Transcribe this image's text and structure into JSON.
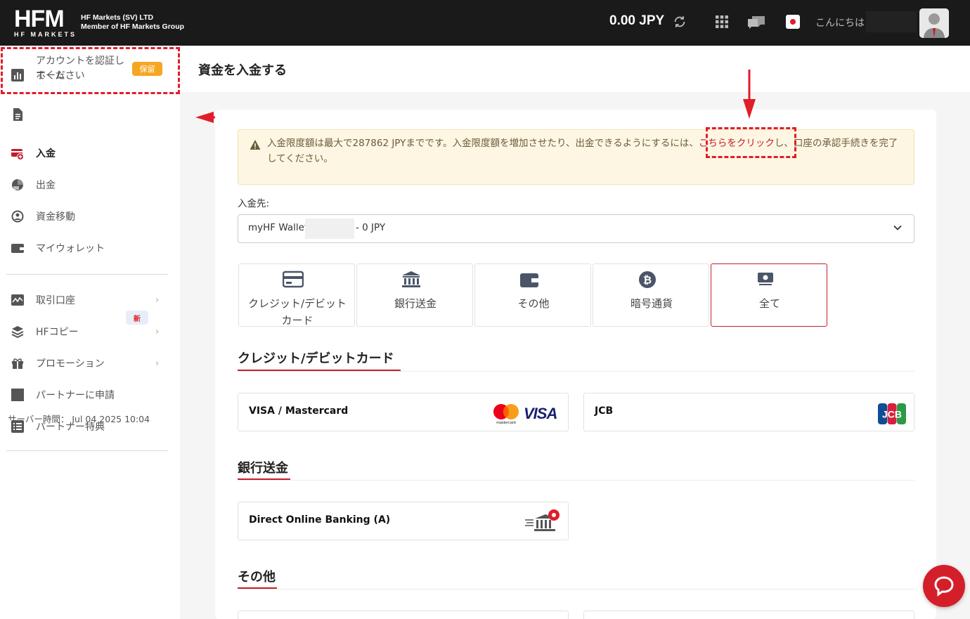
{
  "header": {
    "logo_main": "HFM",
    "logo_sub": "HF MARKETS",
    "company_line1": "HF Markets (SV) LTD",
    "company_line2": "Member of HF Markets Group",
    "balance": "0.00 JPY",
    "greeting": "こんにちは",
    "icons": [
      "refresh-icon",
      "apps-grid-icon",
      "chat-bubbles-icon",
      "japan-flag-icon",
      "user-avatar"
    ]
  },
  "sidebar": {
    "home": "ホーム",
    "verify": "アカウントを認証してください",
    "verify_badge": "保留",
    "deposit": "入金",
    "withdraw": "出金",
    "transfer": "資金移動",
    "wallet": "マイウォレット",
    "trading_accounts": "取引口座",
    "hf_copy": "HFコピー",
    "promotions": "プロモーション",
    "promotions_badge": "新",
    "partner_apply": "パートナーに申請",
    "partner_benefits": "パートナー特典",
    "server_time": "サーバー時間： Jul 04 2025 10:04"
  },
  "main": {
    "page_title": "資金を入金する",
    "alert_text_before": "入金限度額は最大で287862 JPYまでです。入金限度額を増加させたり、出金できるようにするには、",
    "alert_link": "こちらをクリック",
    "alert_text_after": "し、口座の承認手続きを完了してください。",
    "dest_label": "入金先:",
    "wallet_prefix": "myHF Wallet:",
    "wallet_suffix": "- 0 JPY",
    "tabs": [
      {
        "label": "クレジット/デビットカード",
        "icon": "credit-card-icon"
      },
      {
        "label": "銀行送金",
        "icon": "bank-icon"
      },
      {
        "label": "その他",
        "icon": "wallet-icon"
      },
      {
        "label": "暗号通貨",
        "icon": "bitcoin-icon"
      },
      {
        "label": "全て",
        "icon": "cash-icon"
      }
    ],
    "section_cards": "クレジット/デビットカード",
    "card_visa": "VISA / Mastercard",
    "card_jcb": "JCB",
    "section_bank": "銀行送金",
    "bank_direct": "Direct Online Banking (A)",
    "section_other": "その他",
    "logo_texts": {
      "visa": "VISA",
      "mastercard": "mastercard",
      "jcb": "JCB"
    }
  },
  "colors": {
    "brand_red": "#c41e2a",
    "header_bg": "#1a1a1a",
    "badge_orange": "#f5a623",
    "alert_bg": "#fdf6e3"
  }
}
